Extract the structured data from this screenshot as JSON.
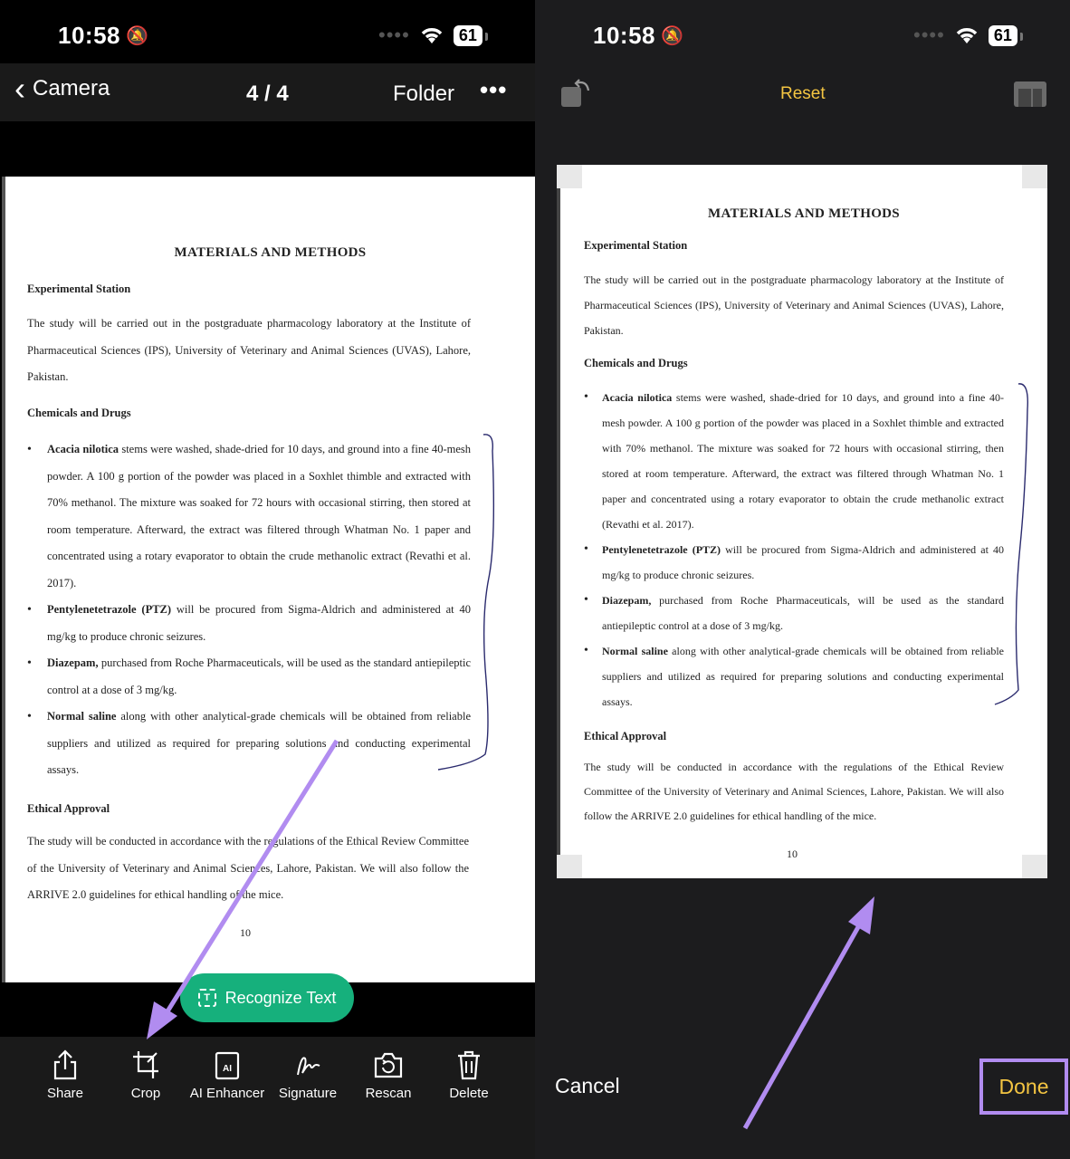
{
  "left": {
    "status": {
      "time": "10:58",
      "battery": "61"
    },
    "header": {
      "back_label": "Camera",
      "page_count": "4 / 4",
      "folder_label": "Folder",
      "more_label": "•••"
    },
    "recognize_label": "Recognize Text",
    "toolbar": [
      "Share",
      "Crop",
      "AI Enhancer",
      "Signature",
      "Rescan",
      "Delete"
    ]
  },
  "right": {
    "status": {
      "time": "10:58",
      "battery": "61"
    },
    "reset_label": "Reset",
    "cancel_label": "Cancel",
    "done_label": "Done"
  },
  "document": {
    "title": "MATERIALS AND METHODS",
    "station_heading": "Experimental Station",
    "station_text": "The study will be carried out in the postgraduate pharmacology laboratory at the Institute of Pharmaceutical Sciences (IPS), University of Veterinary and Animal Sciences (UVAS), Lahore, Pakistan.",
    "chem_heading": "Chemicals and Drugs",
    "bullets": [
      {
        "bold": "Acacia nilotica",
        "text": " stems were washed, shade-dried for 10 days, and ground into a fine 40-mesh powder. A 100 g portion of the powder was placed in a Soxhlet thimble and extracted with 70% methanol. The mixture was soaked for 72 hours with occasional stirring, then stored at room temperature. Afterward, the extract was filtered through Whatman No. 1 paper and concentrated using a rotary evaporator to obtain the crude methanolic extract (Revathi et al. 2017)."
      },
      {
        "bold": "Pentylenetetrazole (PTZ)",
        "text": " will be procured from Sigma-Aldrich and administered at 40 mg/kg to produce chronic seizures."
      },
      {
        "bold": "Diazepam,",
        "text": " purchased from Roche Pharmaceuticals, will be used as the standard antiepileptic control at a dose of 3 mg/kg."
      },
      {
        "bold": "Normal saline",
        "text": " along with other analytical-grade chemicals will be obtained from reliable suppliers and utilized as required for preparing solutions and conducting experimental assays."
      }
    ],
    "ethics_heading": "Ethical Approval",
    "ethics_text": "The study will be conducted in accordance with the regulations of the Ethical Review Committee of the University of Veterinary and Animal Sciences, Lahore, Pakistan. We will also follow the ARRIVE 2.0 guidelines for ethical handling of the mice.",
    "page_number": "10"
  }
}
